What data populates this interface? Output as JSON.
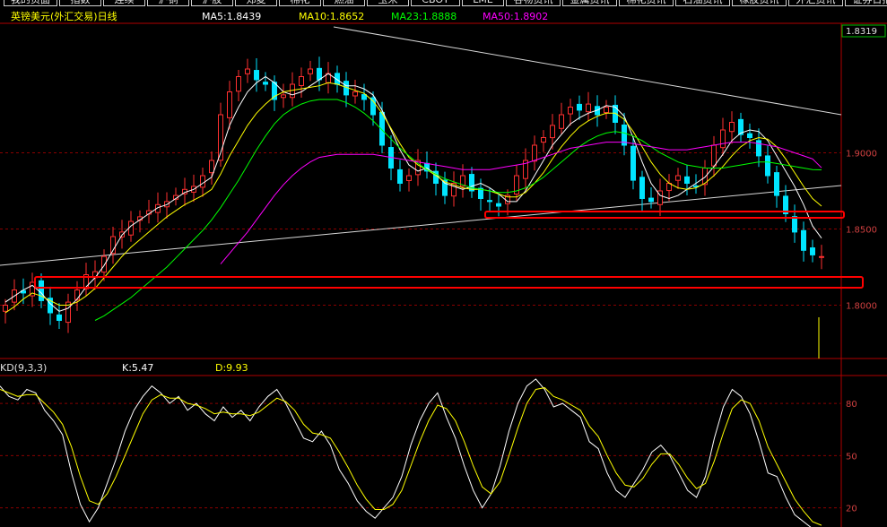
{
  "nav": {
    "tabs": [
      "我的页面",
      "指数",
      "连续",
      "沪铜",
      "沪胶",
      "郑麦",
      "棉花",
      "燃油",
      "玉米",
      "CBOT",
      "LME",
      "谷物资讯",
      "金属资讯",
      "棉花资讯",
      "石油资讯",
      "橡胶资讯",
      "外汇资讯",
      "证券日报",
      "网上评报"
    ]
  },
  "price_panel": {
    "title": "英镑美元(外汇交易)日线",
    "ma_labels": [
      {
        "text": "MA5:1.8439",
        "color": "#ffffff"
      },
      {
        "text": "MA10:1.8652",
        "color": "#ffff00"
      },
      {
        "text": "MA23:1.8888",
        "color": "#00ff00"
      },
      {
        "text": "MA50:1.8902",
        "color": "#ff00ff"
      }
    ],
    "last_price": "1.8319",
    "y_ticks": [
      "1.9000",
      "1.8500",
      "1.8000"
    ]
  },
  "kd_panel": {
    "title": "KD(9,3,3)",
    "k_label": "K:5.47",
    "d_label": "D:9.93",
    "y_ticks": [
      "80",
      "50",
      "20"
    ]
  },
  "colors": {
    "up": "#ff3030",
    "down": "#00e5ff",
    "grid": "#8a0000",
    "axis": "#b00000",
    "ma5": "#ffffff",
    "ma10": "#ffff00",
    "ma23": "#00ff00",
    "ma50": "#ff00ff",
    "k": "#ffffff",
    "d": "#ffff00",
    "box": "#ff0000"
  },
  "chart_data": [
    {
      "type": "candlestick",
      "title": "英镑美元(外汇交易)日线",
      "ylim": [
        1.765,
        1.985
      ],
      "y_ticks": [
        1.8,
        1.85,
        1.9
      ],
      "last_price": 1.8319,
      "ma_last": {
        "MA5": 1.8439,
        "MA10": 1.8652,
        "MA23": 1.8888,
        "MA50": 1.8902
      },
      "series": [
        {
          "name": "MA5",
          "values": [
            1.802,
            1.806,
            1.81,
            1.813,
            1.808,
            1.801,
            1.796,
            1.798,
            1.804,
            1.812,
            1.818,
            1.826,
            1.836,
            1.846,
            1.852,
            1.856,
            1.86,
            1.864,
            1.866,
            1.87,
            1.874,
            1.876,
            1.88,
            1.884,
            1.9,
            1.918,
            1.93,
            1.94,
            1.946,
            1.95,
            1.946,
            1.94,
            1.938,
            1.94,
            1.944,
            1.948,
            1.952,
            1.948,
            1.944,
            1.944,
            1.942,
            1.938,
            1.928,
            1.915,
            1.902,
            1.892,
            1.888,
            1.89,
            1.886,
            1.88,
            1.878,
            1.876,
            1.878,
            1.88,
            1.877,
            1.873,
            1.868,
            1.868,
            1.875,
            1.885,
            1.895,
            1.905,
            1.912,
            1.919,
            1.923,
            1.926,
            1.928,
            1.931,
            1.93,
            1.924,
            1.91,
            1.894,
            1.88,
            1.872,
            1.87,
            1.872,
            1.876,
            1.88,
            1.884,
            1.891,
            1.899,
            1.908,
            1.913,
            1.915,
            1.914,
            1.908,
            1.898,
            1.888,
            1.878,
            1.866,
            1.852,
            1.844
          ]
        },
        {
          "name": "MA10",
          "values": [
            1.795,
            1.799,
            1.804,
            1.808,
            1.806,
            1.803,
            1.8,
            1.8,
            1.802,
            1.806,
            1.811,
            1.818,
            1.825,
            1.832,
            1.838,
            1.843,
            1.848,
            1.853,
            1.858,
            1.862,
            1.866,
            1.869,
            1.872,
            1.876,
            1.886,
            1.898,
            1.908,
            1.918,
            1.926,
            1.932,
            1.937,
            1.94,
            1.941,
            1.942,
            1.943,
            1.944,
            1.946,
            1.945,
            1.943,
            1.941,
            1.939,
            1.934,
            1.926,
            1.916,
            1.906,
            1.897,
            1.892,
            1.889,
            1.885,
            1.881,
            1.879,
            1.877,
            1.876,
            1.876,
            1.875,
            1.873,
            1.871,
            1.871,
            1.874,
            1.88,
            1.887,
            1.896,
            1.904,
            1.911,
            1.917,
            1.921,
            1.924,
            1.926,
            1.926,
            1.922,
            1.914,
            1.904,
            1.894,
            1.886,
            1.88,
            1.877,
            1.876,
            1.877,
            1.88,
            1.885,
            1.891,
            1.898,
            1.904,
            1.908,
            1.91,
            1.909,
            1.904,
            1.896,
            1.887,
            1.878,
            1.87,
            1.865
          ]
        },
        {
          "name": "MA23",
          "values": [
            null,
            null,
            null,
            null,
            null,
            null,
            null,
            null,
            null,
            null,
            1.79,
            1.793,
            1.797,
            1.801,
            1.805,
            1.81,
            1.815,
            1.82,
            1.825,
            1.831,
            1.837,
            1.843,
            1.849,
            1.856,
            1.864,
            1.873,
            1.882,
            1.892,
            1.902,
            1.911,
            1.919,
            1.925,
            1.929,
            1.932,
            1.934,
            1.935,
            1.935,
            1.935,
            1.933,
            1.93,
            1.926,
            1.921,
            1.915,
            1.909,
            1.903,
            1.898,
            1.893,
            1.889,
            1.886,
            1.883,
            1.881,
            1.879,
            1.877,
            1.876,
            1.875,
            1.874,
            1.874,
            1.875,
            1.877,
            1.88,
            1.884,
            1.889,
            1.894,
            1.899,
            1.904,
            1.908,
            1.911,
            1.913,
            1.914,
            1.913,
            1.911,
            1.908,
            1.904,
            1.9,
            1.897,
            1.894,
            1.892,
            1.891,
            1.89,
            1.89,
            1.89,
            1.891,
            1.892,
            1.893,
            1.894,
            1.894,
            1.893,
            1.892,
            1.891,
            1.89,
            1.889,
            1.8888
          ]
        },
        {
          "name": "MA50",
          "values": [
            null,
            null,
            null,
            null,
            null,
            null,
            null,
            null,
            null,
            null,
            null,
            null,
            null,
            null,
            null,
            null,
            null,
            null,
            null,
            null,
            null,
            null,
            null,
            null,
            1.827,
            1.834,
            1.841,
            1.848,
            1.856,
            1.864,
            1.872,
            1.879,
            1.885,
            1.89,
            1.894,
            1.897,
            1.898,
            1.899,
            1.899,
            1.899,
            1.899,
            1.899,
            1.898,
            1.897,
            1.896,
            1.895,
            1.894,
            1.893,
            1.892,
            1.891,
            1.89,
            1.889,
            1.889,
            1.889,
            1.889,
            1.89,
            1.891,
            1.892,
            1.893,
            1.895,
            1.897,
            1.899,
            1.901,
            1.903,
            1.904,
            1.905,
            1.906,
            1.907,
            1.907,
            1.907,
            1.906,
            1.905,
            1.904,
            1.903,
            1.902,
            1.902,
            1.902,
            1.903,
            1.904,
            1.905,
            1.906,
            1.907,
            1.907,
            1.907,
            1.906,
            1.905,
            1.904,
            1.902,
            1.9,
            1.898,
            1.896,
            1.8902
          ]
        }
      ],
      "ohlc_close": [
        1.8,
        1.81,
        1.808,
        1.815,
        1.803,
        1.795,
        1.79,
        1.802,
        1.81,
        1.82,
        1.822,
        1.832,
        1.845,
        1.848,
        1.855,
        1.858,
        1.862,
        1.866,
        1.868,
        1.872,
        1.876,
        1.878,
        1.885,
        1.895,
        1.925,
        1.94,
        1.95,
        1.955,
        1.948,
        1.945,
        1.935,
        1.938,
        1.945,
        1.95,
        1.955,
        1.948,
        1.952,
        1.945,
        1.938,
        1.94,
        1.935,
        1.925,
        1.905,
        1.89,
        1.88,
        1.885,
        1.895,
        1.888,
        1.88,
        1.872,
        1.88,
        1.885,
        1.875,
        1.87,
        1.868,
        1.865,
        1.872,
        1.885,
        1.895,
        1.905,
        1.91,
        1.918,
        1.925,
        1.93,
        1.928,
        1.932,
        1.925,
        1.93,
        1.92,
        1.905,
        1.882,
        1.87,
        1.868,
        1.875,
        1.88,
        1.885,
        1.88,
        1.878,
        1.89,
        1.905,
        1.915,
        1.92,
        1.912,
        1.91,
        1.898,
        1.885,
        1.872,
        1.86,
        1.848,
        1.836,
        1.833,
        1.8319
      ]
    },
    {
      "type": "line",
      "title": "KD(9,3,3)",
      "ylim": [
        10,
        96
      ],
      "y_ticks": [
        80,
        50,
        20
      ],
      "series": [
        {
          "name": "K",
          "values": [
            90,
            84,
            82,
            88,
            86,
            76,
            70,
            62,
            40,
            22,
            12,
            20,
            34,
            48,
            64,
            76,
            84,
            90,
            86,
            80,
            84,
            76,
            80,
            74,
            70,
            78,
            72,
            76,
            70,
            78,
            84,
            88,
            80,
            70,
            60,
            58,
            64,
            56,
            42,
            34,
            24,
            18,
            14,
            20,
            26,
            38,
            56,
            70,
            80,
            86,
            72,
            60,
            44,
            30,
            20,
            28,
            44,
            64,
            80,
            90,
            94,
            88,
            78,
            80,
            76,
            72,
            58,
            54,
            40,
            30,
            26,
            34,
            42,
            52,
            56,
            50,
            40,
            30,
            26,
            38,
            60,
            78,
            88,
            84,
            74,
            58,
            40,
            38,
            26,
            16,
            12,
            8,
            5.47
          ]
        },
        {
          "name": "D",
          "values": [
            88,
            86,
            84,
            85,
            85,
            80,
            75,
            68,
            55,
            38,
            24,
            22,
            28,
            38,
            50,
            62,
            74,
            82,
            85,
            83,
            83,
            80,
            79,
            77,
            74,
            75,
            74,
            74,
            73,
            75,
            79,
            83,
            81,
            76,
            68,
            63,
            62,
            60,
            52,
            43,
            33,
            25,
            19,
            19,
            22,
            30,
            44,
            58,
            70,
            79,
            77,
            70,
            58,
            44,
            32,
            28,
            35,
            50,
            66,
            80,
            88,
            89,
            84,
            82,
            79,
            76,
            67,
            61,
            50,
            40,
            33,
            32,
            37,
            45,
            51,
            51,
            45,
            37,
            31,
            34,
            47,
            63,
            77,
            82,
            80,
            70,
            55,
            45,
            35,
            25,
            18,
            12,
            9.93
          ]
        }
      ]
    }
  ]
}
